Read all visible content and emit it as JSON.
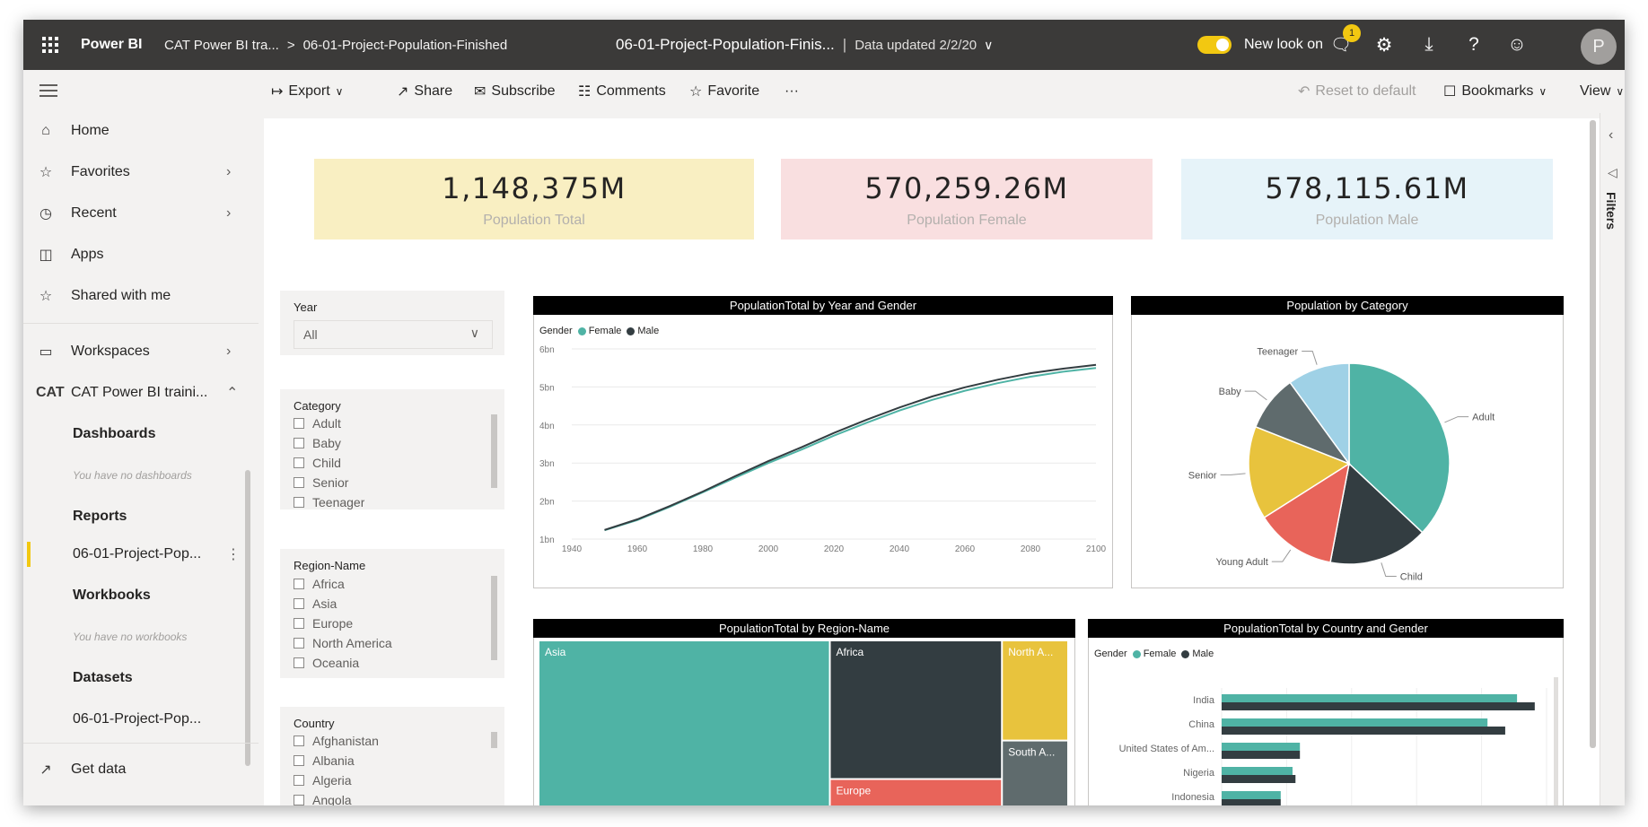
{
  "header": {
    "app_name": "Power BI",
    "breadcrumb_workspace": "CAT Power BI tra...",
    "breadcrumb_sep": ">",
    "breadcrumb_report": "06-01-Project-Population-Finished",
    "report_title": "06-01-Project-Population-Finis...",
    "data_updated": "Data updated 2/2/20",
    "new_look": "New look on",
    "notification_count": "1"
  },
  "nav": {
    "home": "Home",
    "favorites": "Favorites",
    "recent": "Recent",
    "apps": "Apps",
    "shared": "Shared with me",
    "workspaces": "Workspaces",
    "workspace_name": "CAT Power BI traini...",
    "cat_logo": "CAT",
    "dashboards": "Dashboards",
    "no_dashboards": "You have no dashboards",
    "reports": "Reports",
    "report_item": "06-01-Project-Pop...",
    "workbooks": "Workbooks",
    "no_workbooks": "You have no workbooks",
    "datasets": "Datasets",
    "dataset_item": "06-01-Project-Pop...",
    "get_data": "Get data"
  },
  "actionbar": {
    "export": "Export",
    "share": "Share",
    "subscribe": "Subscribe",
    "comments": "Comments",
    "favorite": "Favorite",
    "more": "···",
    "reset": "Reset to default",
    "bookmarks": "Bookmarks",
    "view": "View"
  },
  "filters_pane": {
    "label": "Filters"
  },
  "cards": [
    {
      "value": "1,148,375M",
      "label": "Population Total",
      "color": "#f9efc2"
    },
    {
      "value": "570,259.26M",
      "label": "Population Female",
      "color": "#f9dfe0"
    },
    {
      "value": "578,115.61M",
      "label": "Population Male",
      "color": "#e6f3f9"
    }
  ],
  "slicers": {
    "year": {
      "title": "Year",
      "value": "All"
    },
    "category": {
      "title": "Category",
      "options": [
        "Adult",
        "Baby",
        "Child",
        "Senior",
        "Teenager"
      ]
    },
    "region": {
      "title": "Region-Name",
      "options": [
        "Africa",
        "Asia",
        "Europe",
        "North America",
        "Oceania"
      ]
    },
    "country": {
      "title": "Country",
      "options": [
        "Afghanistan",
        "Albania",
        "Algeria",
        "Angola"
      ]
    }
  },
  "colors": {
    "female": "#4fb3a5",
    "male": "#333d41",
    "yellow": "#e8c33d",
    "red": "#e8645a",
    "gray": "#5f6b6d",
    "lightblue": "#9fd1e6"
  },
  "chart_data": [
    {
      "type": "line",
      "title": "PopulationTotal by Year and Gender",
      "legend_title": "Gender",
      "x": [
        1950,
        1960,
        1970,
        1980,
        1990,
        2000,
        2010,
        2020,
        2030,
        2040,
        2050,
        2060,
        2070,
        2080,
        2090,
        2100
      ],
      "xticks": [
        1940,
        1960,
        1980,
        2000,
        2020,
        2040,
        2060,
        2080,
        2100
      ],
      "yticks": [
        "1bn",
        "2bn",
        "3bn",
        "4bn",
        "5bn",
        "6bn"
      ],
      "ylim": [
        1,
        6
      ],
      "series": [
        {
          "name": "Female",
          "values": [
            1.23,
            1.5,
            1.85,
            2.23,
            2.62,
            3.0,
            3.35,
            3.72,
            4.06,
            4.38,
            4.66,
            4.9,
            5.1,
            5.27,
            5.4,
            5.5
          ]
        },
        {
          "name": "Male",
          "values": [
            1.24,
            1.52,
            1.87,
            2.25,
            2.66,
            3.05,
            3.41,
            3.79,
            4.14,
            4.46,
            4.75,
            4.99,
            5.19,
            5.36,
            5.48,
            5.58
          ]
        }
      ]
    },
    {
      "type": "pie",
      "title": "Population by Category",
      "categories": [
        "Adult",
        "Child",
        "Young Adult",
        "Senior",
        "Baby",
        "Teenager"
      ],
      "values": [
        37,
        16,
        13,
        15,
        9,
        10
      ]
    },
    {
      "type": "treemap",
      "title": "PopulationTotal by Region-Name",
      "categories": [
        "Asia",
        "Africa",
        "Europe",
        "North A...",
        "South A..."
      ],
      "values": [
        55,
        27,
        5.5,
        7.5,
        5
      ]
    },
    {
      "type": "bar",
      "title": "PopulationTotal by Country and Gender",
      "legend_title": "Gender",
      "categories": [
        "India",
        "China",
        "United States of Am...",
        "Nigeria",
        "Indonesia"
      ],
      "series": [
        {
          "name": "Female",
          "values": [
            100,
            90,
            26.5,
            24,
            20
          ]
        },
        {
          "name": "Male",
          "values": [
            106,
            96,
            26.5,
            25,
            20
          ]
        }
      ]
    }
  ]
}
